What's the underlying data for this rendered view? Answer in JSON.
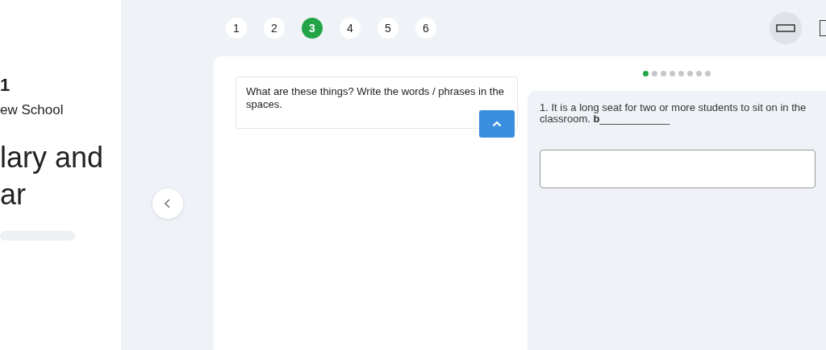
{
  "sidebar": {
    "number": "1",
    "school": "ew School",
    "title_lines": [
      "lary and",
      "ar"
    ],
    "progress": {
      "level": 0
    }
  },
  "question_tabs": [
    {
      "label": "1",
      "selected": false
    },
    {
      "label": "2",
      "selected": false
    },
    {
      "label": "3",
      "selected": true
    },
    {
      "label": "4",
      "selected": false
    },
    {
      "label": "5",
      "selected": false
    },
    {
      "label": "6",
      "selected": false
    }
  ],
  "instruction": "What are these things? Write the words / phrases in the spaces.",
  "page_dots": [
    {
      "selected": true
    },
    {
      "selected": false
    },
    {
      "selected": false
    },
    {
      "selected": false
    },
    {
      "selected": false
    },
    {
      "selected": false
    },
    {
      "selected": false
    },
    {
      "selected": false
    }
  ],
  "item": {
    "prompt": "1. It is a long seat for two or more students to sit on in the classroom. **b**____________"
  }
}
